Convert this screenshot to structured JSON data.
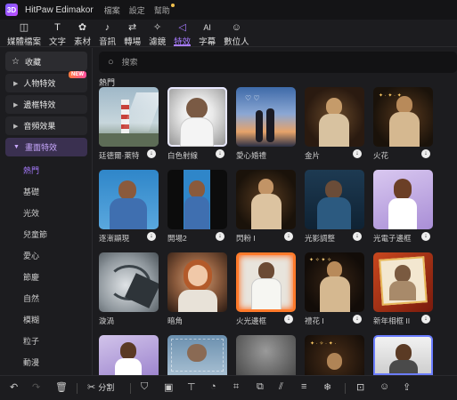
{
  "app": {
    "logo_text": "3D",
    "title": "HitPaw Edimakor",
    "menu": [
      "檔案",
      "設定",
      "幫助"
    ]
  },
  "toolbar": {
    "items": [
      {
        "label": "媒體檔案",
        "icon": "media-icon",
        "glyph": "◫"
      },
      {
        "label": "文字",
        "icon": "text-icon",
        "glyph": "T"
      },
      {
        "label": "素材",
        "icon": "sticker-icon",
        "glyph": "✿"
      },
      {
        "label": "音訊",
        "icon": "music-icon",
        "glyph": "♪"
      },
      {
        "label": "轉場",
        "icon": "transition-icon",
        "glyph": "⇄"
      },
      {
        "label": "濾鏡",
        "icon": "filter-icon",
        "glyph": "✧"
      },
      {
        "label": "特效",
        "icon": "effects-icon",
        "glyph": "◁"
      },
      {
        "label": "字幕",
        "icon": "subtitle-icon",
        "glyph": "AI"
      },
      {
        "label": "數位人",
        "icon": "avatar-icon",
        "glyph": "☺"
      }
    ],
    "active": "特效"
  },
  "sidebar": {
    "favorites": {
      "label": "收藏",
      "icon": "star-icon"
    },
    "categories": [
      {
        "label": "人物特效",
        "badge": "NEW"
      },
      {
        "label": "邊框特效",
        "badge": ""
      },
      {
        "label": "音頻效果",
        "badge": ""
      },
      {
        "label": "畫面特效",
        "badge": ""
      }
    ],
    "subitems": [
      "熱門",
      "基礎",
      "光效",
      "兒童節",
      "愛心",
      "節慶",
      "自然",
      "模糊",
      "粒子",
      "動漫"
    ],
    "active_sub": "熱門"
  },
  "search": {
    "placeholder": "搜索",
    "value": ""
  },
  "section_title": "熱門",
  "effects": [
    {
      "name": "廷德爾·萊特"
    },
    {
      "name": "白色射線"
    },
    {
      "name": "愛心婚禮"
    },
    {
      "name": "金片"
    },
    {
      "name": "火花"
    },
    {
      "name": "逐漸顯現"
    },
    {
      "name": "開場2"
    },
    {
      "name": "閃粉 I"
    },
    {
      "name": "光影調整"
    },
    {
      "name": "光電子邊框"
    },
    {
      "name": "漩渦"
    },
    {
      "name": "暗角"
    },
    {
      "name": "火光邊框"
    },
    {
      "name": "禮花 I"
    },
    {
      "name": "新年相框 II"
    },
    {
      "name": ""
    },
    {
      "name": ""
    },
    {
      "name": ""
    },
    {
      "name": ""
    },
    {
      "name": ""
    }
  ],
  "bottombar": {
    "split_label": "分割"
  },
  "colors": {
    "accent": "#a77bff",
    "background": "#1c1c1f"
  }
}
